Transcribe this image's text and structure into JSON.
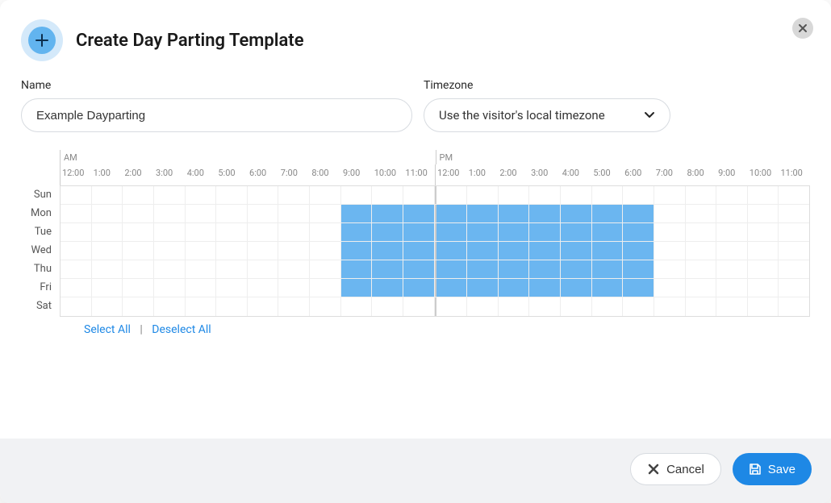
{
  "modal": {
    "title": "Create Day Parting Template",
    "close_icon": "close"
  },
  "form": {
    "name_label": "Name",
    "name_value": "Example Dayparting",
    "timezone_label": "Timezone",
    "timezone_value": "Use the visitor's local timezone"
  },
  "schedule": {
    "am_label": "AM",
    "pm_label": "PM",
    "hours": [
      "12:00",
      "1:00",
      "2:00",
      "3:00",
      "4:00",
      "5:00",
      "6:00",
      "7:00",
      "8:00",
      "9:00",
      "10:00",
      "11:00",
      "12:00",
      "1:00",
      "2:00",
      "3:00",
      "4:00",
      "5:00",
      "6:00",
      "7:00",
      "8:00",
      "9:00",
      "10:00",
      "11:00"
    ],
    "days": [
      "Sun",
      "Mon",
      "Tue",
      "Wed",
      "Thu",
      "Fri",
      "Sat"
    ],
    "selected": {
      "Sun": [],
      "Mon": [
        9,
        10,
        11,
        12,
        13,
        14,
        15,
        16,
        17,
        18
      ],
      "Tue": [
        9,
        10,
        11,
        12,
        13,
        14,
        15,
        16,
        17,
        18
      ],
      "Wed": [
        9,
        10,
        11,
        12,
        13,
        14,
        15,
        16,
        17,
        18
      ],
      "Thu": [
        9,
        10,
        11,
        12,
        13,
        14,
        15,
        16,
        17,
        18
      ],
      "Fri": [
        9,
        10,
        11,
        12,
        13,
        14,
        15,
        16,
        17,
        18
      ],
      "Sat": []
    },
    "select_all_label": "Select All",
    "deselect_all_label": "Deselect All"
  },
  "footer": {
    "cancel_label": "Cancel",
    "save_label": "Save"
  }
}
